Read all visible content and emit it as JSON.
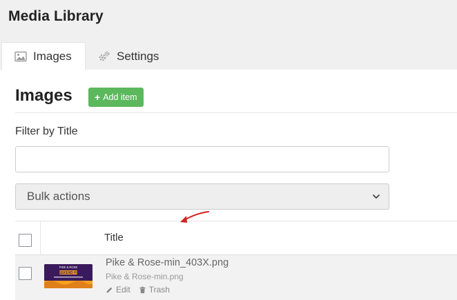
{
  "page": {
    "title": "Media Library"
  },
  "tabs": [
    {
      "label": "Images",
      "icon": "image-icon",
      "active": true
    },
    {
      "label": "Settings",
      "icon": "gears-icon",
      "active": false
    }
  ],
  "section": {
    "title": "Images",
    "add_button": "Add item"
  },
  "filter": {
    "label": "Filter by Title",
    "value": "",
    "placeholder": ""
  },
  "bulk": {
    "selected": "Bulk actions"
  },
  "table": {
    "columns": [
      "Title"
    ],
    "rows": [
      {
        "title": "Pike & Rose-min_403X.png",
        "filename": "Pike & Rose-min.png",
        "thumbnail_text": [
          "PIKE & ROSE",
          "WEEKEND FUN"
        ],
        "actions": {
          "edit": "Edit",
          "trash": "Trash"
        }
      }
    ]
  },
  "colors": {
    "accent_green": "#5cb85c",
    "annotation_red": "#d62020",
    "thumbnail_orange": "#f7a21b"
  }
}
